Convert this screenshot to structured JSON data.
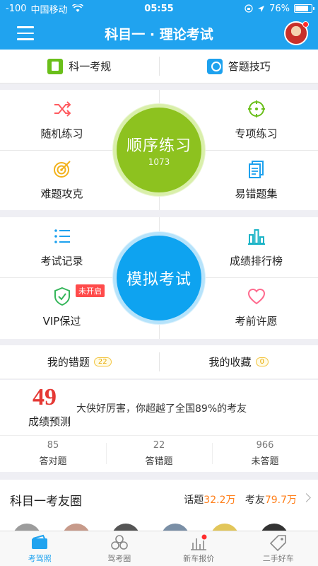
{
  "status_bar": {
    "signal": "-100",
    "carrier": "中国移动",
    "time": "05:55",
    "battery": "76%",
    "battery_level": 0.76
  },
  "header": {
    "title": "科目一 · 理论考试",
    "menu_icon": "menu-icon",
    "avatar": "avatar"
  },
  "quick_links": [
    {
      "label": "科一考规",
      "icon": "rules-book-icon"
    },
    {
      "label": "答题技巧",
      "icon": "tips-icon"
    }
  ],
  "practice": {
    "center_label": "顺序练习",
    "center_count": "1073",
    "items": [
      {
        "label": "随机练习",
        "icon": "shuffle-icon"
      },
      {
        "label": "专项练习",
        "icon": "target-crosshair-icon"
      },
      {
        "label": "难题攻克",
        "icon": "bullseye-icon"
      },
      {
        "label": "易错题集",
        "icon": "document-stack-icon"
      }
    ]
  },
  "exam": {
    "center_label": "模拟考试",
    "items": [
      {
        "label": "考试记录",
        "icon": "list-icon"
      },
      {
        "label": "成绩排行榜",
        "icon": "bar-chart-icon"
      },
      {
        "label": "VIP保过",
        "icon": "shield-check-icon",
        "badge": "未开启"
      },
      {
        "label": "考前许愿",
        "icon": "heart-icon"
      }
    ]
  },
  "collections": [
    {
      "label": "我的错题",
      "count": "22"
    },
    {
      "label": "我的收藏",
      "count": "0"
    }
  ],
  "prediction": {
    "score": "49",
    "score_label": "成绩预测",
    "message": "大侠好厉害，你超越了全国89%的考友",
    "stats": [
      {
        "value": "85",
        "label": "答对题"
      },
      {
        "value": "22",
        "label": "答错题"
      },
      {
        "value": "966",
        "label": "未答题"
      }
    ]
  },
  "community": {
    "name": "科目一考友圈",
    "topics_label": "话题",
    "topics_value": "32.2万",
    "friends_label": "考友",
    "friends_value": "79.7万"
  },
  "tabs": [
    {
      "label": "考驾照",
      "icon": "license-card-icon",
      "active": true
    },
    {
      "label": "驾考圈",
      "icon": "circles-icon",
      "active": false
    },
    {
      "label": "新车报价",
      "icon": "price-chart-icon",
      "active": false
    },
    {
      "label": "二手好车",
      "icon": "price-tag-icon",
      "active": false
    }
  ],
  "colors": {
    "brand_blue": "#20a3ef",
    "practice_green": "#8dc21f",
    "exam_blue": "#0ea3f0",
    "score_red": "#e53935",
    "highlight_orange": "#ff7f1a"
  }
}
